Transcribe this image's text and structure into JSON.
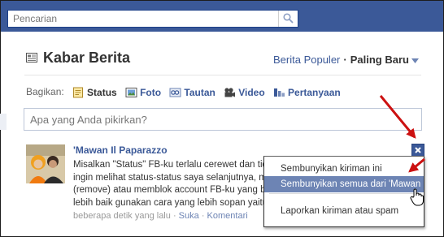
{
  "search": {
    "placeholder": "Pencarian",
    "icon": "search-icon"
  },
  "header": {
    "title": "Kabar Berita",
    "sort_popular": "Berita Populer",
    "sort_separator": "·",
    "sort_latest": "Paling Baru"
  },
  "share": {
    "label": "Bagikan:",
    "items": [
      {
        "label": "Status",
        "icon": "status-icon"
      },
      {
        "label": "Foto",
        "icon": "photo-icon"
      },
      {
        "label": "Tautan",
        "icon": "link-icon"
      },
      {
        "label": "Video",
        "icon": "video-icon"
      },
      {
        "label": "Pertanyaan",
        "icon": "question-icon"
      }
    ]
  },
  "composer": {
    "placeholder": "Apa yang Anda pikirkan?"
  },
  "story": {
    "author": "'Mawan Il Paparazzo",
    "lines": [
      "Misalkan \"Status\" FB-ku terlalu cerewet dan tidak",
      "ingin melihat status-status saya selanjutnya, ma",
      "(remove) atau memblok account FB-ku yang bis",
      "lebih baik gunakan cara yang lebih sopan yaitu"
    ],
    "time": "beberapa detik yang lalu",
    "sep": "·",
    "like": "Suka",
    "comment": "Komentari"
  },
  "menu": {
    "items": [
      "Sembunyikan kiriman ini",
      "Sembunyikan semua dari 'Mawan",
      "Laporkan kiriman atau spam"
    ]
  },
  "colors": {
    "topbar": "#3b5998",
    "link": "#3b5998",
    "highlight": "#6d84b4",
    "arrow": "#cc1111"
  }
}
